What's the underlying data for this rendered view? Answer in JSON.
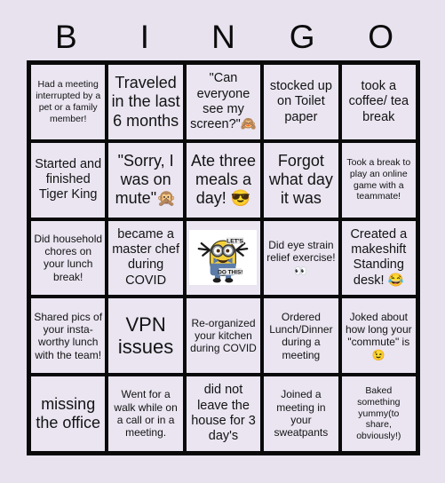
{
  "card": {
    "title": "BINGO",
    "header_letters": [
      "B",
      "I",
      "N",
      "G",
      "O"
    ],
    "background_color": "#e8e2ef",
    "cell_color": "#eae5f1",
    "border_color": "#0a0a0a",
    "text_color": "#131313",
    "grid_size": "5x5"
  },
  "cells": [
    {
      "row": 1,
      "col": 1,
      "column_letter": "B",
      "text": "Had a meeting interrupted by a pet or a family member!",
      "size": "fs-xs"
    },
    {
      "row": 1,
      "col": 2,
      "column_letter": "I",
      "text": "Traveled in the last 6 months",
      "size": "fs-l"
    },
    {
      "row": 1,
      "col": 3,
      "column_letter": "N",
      "text": "\"Can everyone see my screen?\"🙈",
      "size": "fs-m"
    },
    {
      "row": 1,
      "col": 4,
      "column_letter": "G",
      "text": "stocked up on Toilet paper",
      "size": "fs-m"
    },
    {
      "row": 1,
      "col": 5,
      "column_letter": "O",
      "text": "took a coffee/ tea break",
      "size": "fs-m"
    },
    {
      "row": 2,
      "col": 1,
      "column_letter": "B",
      "text": "Started and finished Tiger King",
      "size": "fs-m"
    },
    {
      "row": 2,
      "col": 2,
      "column_letter": "I",
      "text": "\"Sorry, I was on mute\"🙊",
      "size": "fs-l"
    },
    {
      "row": 2,
      "col": 3,
      "column_letter": "N",
      "text": "Ate three meals a day! 😎",
      "size": "fs-l"
    },
    {
      "row": 2,
      "col": 4,
      "column_letter": "G",
      "text": "Forgot what day it was",
      "size": "fs-l"
    },
    {
      "row": 2,
      "col": 5,
      "column_letter": "O",
      "text": "Took a break to play an online game with a teammate!",
      "size": "fs-xs"
    },
    {
      "row": 3,
      "col": 1,
      "column_letter": "B",
      "text": "Did household chores on your lunch break!",
      "size": "fs-s"
    },
    {
      "row": 3,
      "col": 2,
      "column_letter": "I",
      "text": "became a master chef during COVID",
      "size": "fs-m"
    },
    {
      "row": 3,
      "col": 3,
      "column_letter": "N",
      "type": "image",
      "image_name": "minion-lets-do-this-meme",
      "image_caption_top": "LET'S",
      "image_caption_bottom": "DO THIS!",
      "text": ""
    },
    {
      "row": 3,
      "col": 4,
      "column_letter": "G",
      "text": "Did eye strain relief exercise! 👀",
      "size": "fs-s"
    },
    {
      "row": 3,
      "col": 5,
      "column_letter": "O",
      "text": "Created a makeshift Standing desk! 😂",
      "size": "fs-m"
    },
    {
      "row": 4,
      "col": 1,
      "column_letter": "B",
      "text": "Shared pics of your insta-worthy lunch with the team!",
      "size": "fs-s"
    },
    {
      "row": 4,
      "col": 2,
      "column_letter": "I",
      "text": "VPN issues",
      "size": "fs-xl"
    },
    {
      "row": 4,
      "col": 3,
      "column_letter": "N",
      "text": "Re-organized your kitchen during COVID",
      "size": "fs-s"
    },
    {
      "row": 4,
      "col": 4,
      "column_letter": "G",
      "text": "Ordered Lunch/Dinner during a meeting",
      "size": "fs-s"
    },
    {
      "row": 4,
      "col": 5,
      "column_letter": "O",
      "text": "Joked about how long your \"commute\" is 😉",
      "size": "fs-s"
    },
    {
      "row": 5,
      "col": 1,
      "column_letter": "B",
      "text": "missing the office",
      "size": "fs-l"
    },
    {
      "row": 5,
      "col": 2,
      "column_letter": "I",
      "text": "Went for a walk while on a call or in a meeting.",
      "size": "fs-s"
    },
    {
      "row": 5,
      "col": 3,
      "column_letter": "N",
      "text": "did not leave the house for 3 day's",
      "size": "fs-m"
    },
    {
      "row": 5,
      "col": 4,
      "column_letter": "G",
      "text": "Joined a meeting in your sweatpants",
      "size": "fs-s"
    },
    {
      "row": 5,
      "col": 5,
      "column_letter": "O",
      "text": "Baked something yummy(to share, obviously!)",
      "size": "fs-xs"
    }
  ]
}
